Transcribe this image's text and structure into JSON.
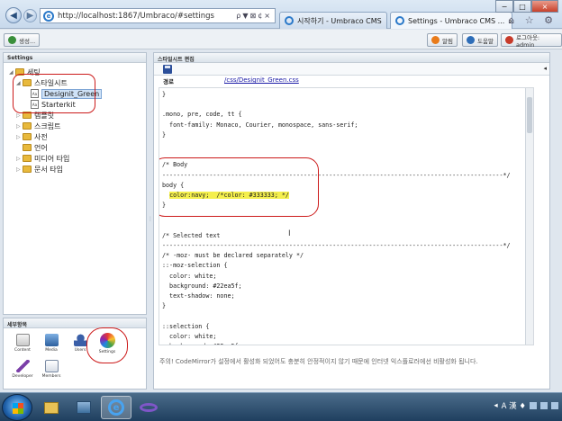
{
  "browser": {
    "url": "http://localhost:1867/Umbraco/#settings",
    "address_tools": "ρ▼⊠¢×",
    "tabs": [
      {
        "label": "시작하기 - Umbraco CMS",
        "close": "×"
      },
      {
        "label": "Settings - Umbraco CMS ...",
        "close": "×"
      }
    ],
    "window_buttons": {
      "minimize": "−",
      "maximize": "□",
      "close": "×"
    },
    "right_tools": "⌂ ☆ ⚙"
  },
  "topbar": {
    "create_label": "생성...",
    "help_orange_label": "알림",
    "help_blue_label": "도움말",
    "logout_label": "로그아웃: admin"
  },
  "tree": {
    "header": "Settings",
    "items": [
      {
        "label": "세팅",
        "toggle": "◢"
      },
      {
        "label": "스타일시트",
        "toggle": "◢"
      },
      {
        "label": "Designit_Green",
        "icon_text": "Aa"
      },
      {
        "label": "Starterkit",
        "icon_text": "Aa"
      },
      {
        "label": "템플릿",
        "toggle": "▷"
      },
      {
        "label": "스크립트",
        "toggle": "▷"
      },
      {
        "label": "사전",
        "toggle": "▷"
      },
      {
        "label": "언어",
        "toggle": ""
      },
      {
        "label": "미디어 타입",
        "toggle": "▷"
      },
      {
        "label": "문서 타입",
        "toggle": "▷"
      }
    ]
  },
  "sections": {
    "header": "세부항목",
    "items": [
      {
        "label": "Content"
      },
      {
        "label": "Media"
      },
      {
        "label": "Users"
      },
      {
        "label": "Settings"
      },
      {
        "label": "Developer"
      },
      {
        "label": "Members"
      }
    ]
  },
  "splitter_glyph": "⋮",
  "editor": {
    "header": "스타일시트 편집",
    "right_arrow": "◂",
    "file_label": "경로",
    "file_path": "/css/Designit_Green.css",
    "code_lines": [
      "}",
      "",
      ".mono, pre, code, tt {",
      "  font-family: Monaco, Courier, monospace, sans-serif;",
      "}",
      "",
      "",
      "/* Body",
      "----------------------------------------------------------------------------------------------*/",
      "body {",
      "  color:navy;  /*color: #333333; */",
      "}",
      "",
      "",
      "/* Selected text",
      "----------------------------------------------------------------------------------------------*/",
      "/* -moz- must be declared separately */",
      "::-moz-selection {",
      "  color: white;",
      "  background: #22ea5f;",
      "  text-shadow: none;",
      "}",
      "",
      "::selection {",
      "  color: white;",
      "  background: #22ea5f;"
    ],
    "cursor_glyph": "I",
    "note": "주의! CodeMirror가 설정에서 활성화 되었어도 충분히 안정적이지 않기 때문에 인터넷 익스플로러에선 비활성화 됩니다."
  },
  "taskbar": {
    "tray_text": "A 漢 ♦",
    "clock": "",
    "arrow": "◂"
  }
}
